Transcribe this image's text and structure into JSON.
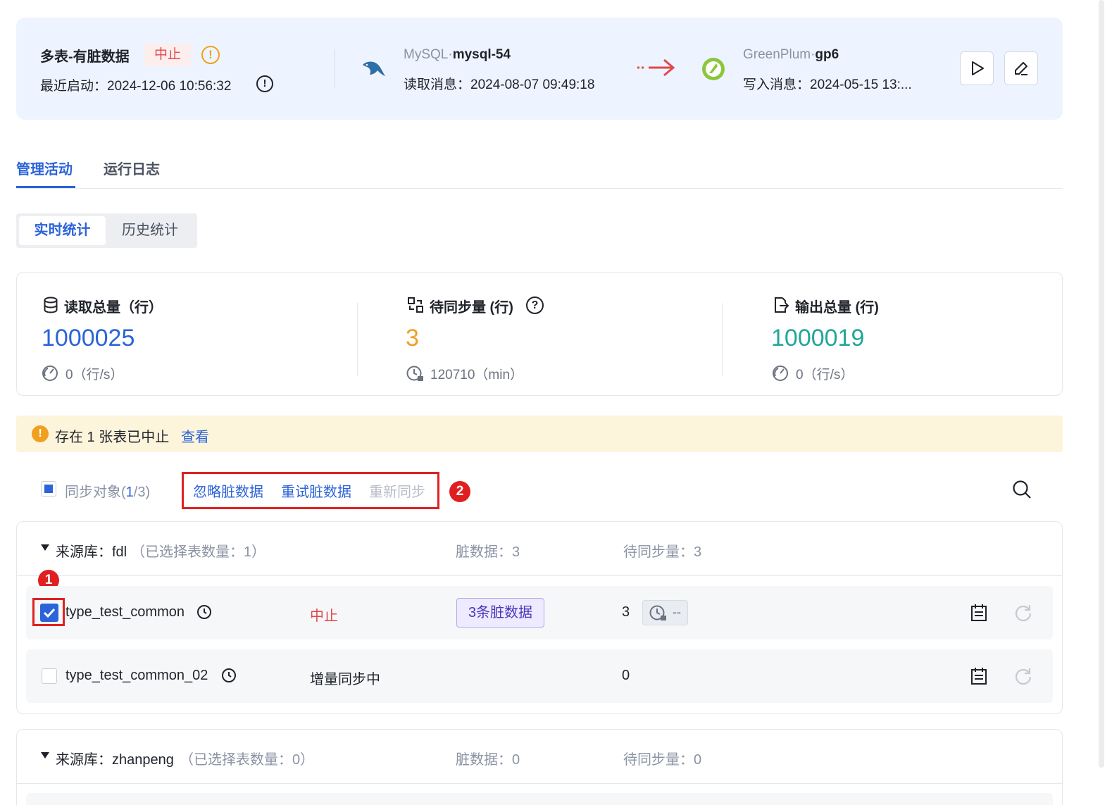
{
  "header": {
    "title": "多表-有脏数据",
    "status_badge": "中止",
    "recent_start": "最近启动：2024-12-06 10:56:32",
    "source": {
      "type": "MySQL·",
      "name": "mysql-54",
      "read_msg": "读取消息：2024-08-07 09:49:18"
    },
    "target": {
      "type": "GreenPlum·",
      "name": "gp6",
      "write_msg": "写入消息：2024-05-15 13:..."
    }
  },
  "tabs": [
    {
      "label": "管理活动"
    },
    {
      "label": "运行日志"
    }
  ],
  "segment": {
    "realtime": "实时统计",
    "history": "历史统计"
  },
  "stats": {
    "read": {
      "label": "读取总量（行）",
      "value": "1000025",
      "sub": "0（行/s）",
      "color": "#2b63d9"
    },
    "pending": {
      "label": "待同步量 (行)",
      "value": "3",
      "sub": "120710（min）",
      "color": "#f0a020"
    },
    "output": {
      "label": "输出总量 (行)",
      "value": "1000019",
      "sub": "0（行/s）",
      "color": "#22a699"
    }
  },
  "warning": {
    "text": "存在 1 张表已中止",
    "link": "查看"
  },
  "toolbar": {
    "sync_prefix": "同步对象(",
    "sync_count": "1",
    "sync_suffix": "/3)",
    "ignore": "忽略脏数据",
    "retry": "重试脏数据",
    "resync": "重新同步",
    "marker2": "2"
  },
  "groups": [
    {
      "source_label": "来源库：fdl",
      "selected": "（已选择表数量：1）",
      "dirty": "脏数据：3",
      "pending": "待同步量：3",
      "rows": [
        {
          "name": "type_test_common",
          "status": "中止",
          "dirty_btn": "3条脏数据",
          "pending": "3",
          "pill_text": "--",
          "checked": true
        },
        {
          "name": "type_test_common_02",
          "status": "增量同步中",
          "pending": "0",
          "checked": false
        }
      ]
    },
    {
      "source_label": "来源库：zhanpeng",
      "selected": "（已选择表数量：0）",
      "dirty": "脏数据：0",
      "pending": "待同步量：0"
    }
  ],
  "marker1": "1"
}
